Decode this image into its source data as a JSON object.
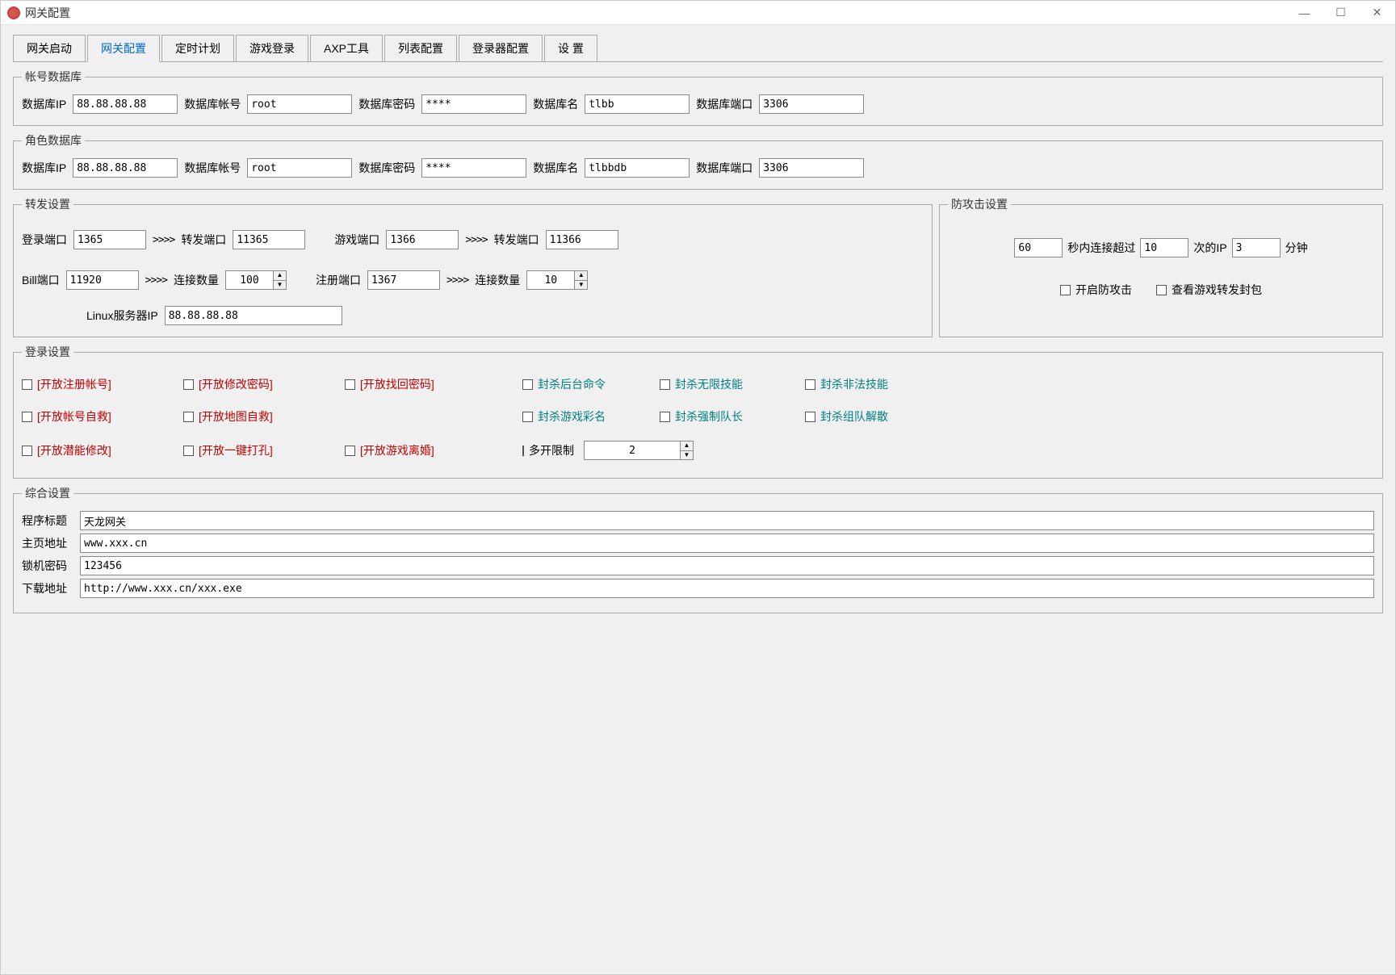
{
  "window": {
    "title": "网关配置"
  },
  "tabs": [
    "网关启动",
    "网关配置",
    "定时计划",
    "游戏登录",
    "AXP工具",
    "列表配置",
    "登录器配置",
    "设 置"
  ],
  "active_tab": 1,
  "account_db": {
    "legend": "帐号数据库",
    "ip_label": "数据库IP",
    "ip": "88.88.88.88",
    "user_label": "数据库帐号",
    "user": "root",
    "pw_label": "数据库密码",
    "pw": "****",
    "name_label": "数据库名",
    "name": "tlbb",
    "port_label": "数据库端口",
    "port": "3306"
  },
  "role_db": {
    "legend": "角色数据库",
    "ip_label": "数据库IP",
    "ip": "88.88.88.88",
    "user_label": "数据库帐号",
    "user": "root",
    "pw_label": "数据库密码",
    "pw": "****",
    "name_label": "数据库名",
    "name": "tlbbdb",
    "port_label": "数据库端口",
    "port": "3306"
  },
  "forward": {
    "legend": "转发设置",
    "login_port_label": "登录端口",
    "login_port": "1365",
    "fwd_port_label": "转发端口",
    "fwd_port": "11365",
    "game_port_label": "游戏端口",
    "game_port": "1366",
    "fwd_port2_label": "转发端口",
    "fwd_port2": "11366",
    "bill_port_label": "Bill端口",
    "bill_port": "11920",
    "conn_count_label": "连接数量",
    "conn_count": "100",
    "reg_port_label": "注册端口",
    "reg_port": "1367",
    "conn_count2_label": "连接数量",
    "conn_count2": "10",
    "linux_ip_label": "Linux服务器IP",
    "linux_ip": "88.88.88.88",
    "arrows": ">>>>"
  },
  "attack": {
    "legend": "防攻击设置",
    "seconds": "60",
    "sec_label": "秒内连接超过",
    "times": "10",
    "times_label": "次的IP",
    "minutes": "3",
    "min_label": "分钟",
    "enable_label": "开启防攻击",
    "view_label": "查看游戏转发封包"
  },
  "login": {
    "legend": "登录设置",
    "open_reg": "[开放注册帐号]",
    "open_modpw": "[开放修改密码]",
    "open_findpw": "[开放找回密码]",
    "ban_console": "封杀后台命令",
    "ban_infskill": "封杀无限技能",
    "ban_illegalskill": "封杀非法技能",
    "open_selfhelp": "[开放帐号自救]",
    "open_maphelp": "[开放地图自救]",
    "ban_colorname": "封杀游戏彩名",
    "ban_forceleader": "封杀强制队长",
    "ban_disband": "封杀组队解散",
    "open_potential": "[开放潜能修改]",
    "open_drill": "[开放一键打孔]",
    "open_divorce": "[开放游戏离婚]",
    "multi_label": "多开限制",
    "multi_val": "2"
  },
  "general": {
    "legend": "综合设置",
    "title_label": "程序标题",
    "title": "天龙网关",
    "home_label": "主页地址",
    "home": "www.xxx.cn",
    "lockpw_label": "锁机密码",
    "lockpw": "123456",
    "dl_label": "下载地址",
    "dl": "http://www.xxx.cn/xxx.exe"
  }
}
